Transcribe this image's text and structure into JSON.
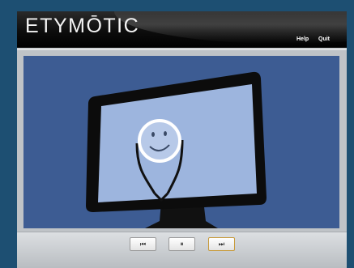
{
  "header": {
    "logo_text": "ETYMŌTIC",
    "help_label": "Help",
    "quit_label": "Quit"
  },
  "controls": {
    "rewind_icon": "⏮",
    "pause_icon": "⏸",
    "forward_icon": "⏭"
  },
  "colors": {
    "page_background": "#1d4f72",
    "stage_background": "#3d5c93",
    "screen_fill": "#9db5de",
    "forward_button_border": "#c79a3a"
  }
}
